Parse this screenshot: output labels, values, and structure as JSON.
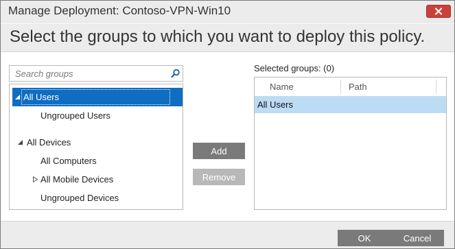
{
  "dialog": {
    "title": "Manage Deployment: Contoso-VPN-Win10",
    "heading": "Select the groups to which you want to deploy this policy."
  },
  "search": {
    "placeholder": "Search groups",
    "value": ""
  },
  "tree": {
    "items": [
      {
        "label": "All Users",
        "level": 0,
        "expander": "expanded",
        "selected": true
      },
      {
        "label": "Ungrouped Users",
        "level": 1,
        "expander": "none",
        "selected": false
      },
      {
        "label": "All Devices",
        "level": 0,
        "expander": "expanded",
        "selected": false
      },
      {
        "label": "All Computers",
        "level": 1,
        "expander": "none",
        "selected": false
      },
      {
        "label": "All Mobile Devices",
        "level": 1,
        "expander": "collapsed",
        "selected": false
      },
      {
        "label": "Ungrouped Devices",
        "level": 1,
        "expander": "none",
        "selected": false
      }
    ]
  },
  "actions": {
    "add_label": "Add",
    "remove_label": "Remove",
    "remove_enabled": false
  },
  "selected_groups": {
    "label": "Selected groups: (0)",
    "columns": [
      "Name",
      "Path"
    ],
    "rows": [
      {
        "name": "All Users",
        "path": "",
        "highlighted": true
      }
    ]
  },
  "footer": {
    "ok_label": "OK",
    "cancel_label": "Cancel"
  },
  "colors": {
    "title_band": "#ececec",
    "selection_blue": "#0f6dc2",
    "row_highlight": "#bcdcf4",
    "close_red": "#c9413a",
    "button_gray": "#7a7a7a",
    "button_disabled": "#b8b8b8"
  }
}
